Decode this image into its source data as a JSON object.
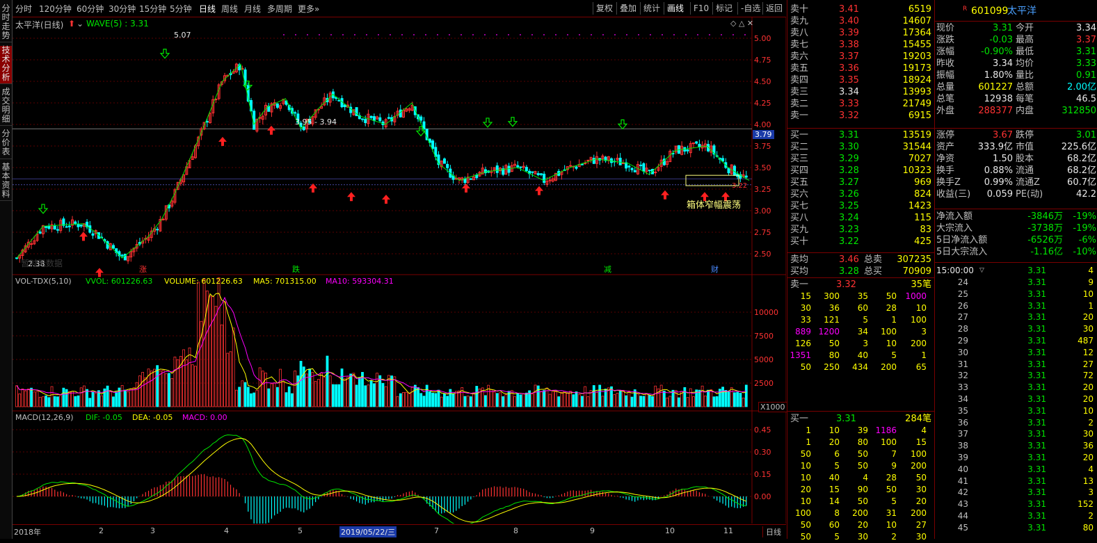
{
  "sidebar": {
    "tabs": [
      {
        "label": "分时走势",
        "active": false
      },
      {
        "label": "技术分析",
        "active": true
      },
      {
        "label": "成交明细",
        "active": false
      },
      {
        "label": "分价表",
        "active": false
      },
      {
        "label": "基本资料",
        "active": false
      }
    ]
  },
  "toolbar": {
    "periods": [
      "分时",
      "120分钟",
      "60分钟",
      "30分钟",
      "15分钟",
      "5分钟",
      "日线",
      "周线",
      "月线",
      "多周期",
      "更多»"
    ],
    "selected_period": "日线",
    "right_buttons": [
      "复权",
      "叠加",
      "统计",
      "画线",
      "F10",
      "标记",
      "-自选",
      "返回"
    ],
    "selected_right": "画线"
  },
  "main_chart": {
    "title": "太平洋(日线)",
    "indicator": "WAVE(5) : 3.31",
    "high_label": "5.07",
    "low_label": "2.38",
    "mark_label": "3.95 - 3.94",
    "last_label": "3.22",
    "current_price_tag": "3.79",
    "annotation": "箱体窄幅震荡",
    "ghost_text": "暂时无数据",
    "y_ticks": [
      "5.00",
      "4.75",
      "4.50",
      "4.25",
      "4.00",
      "3.75",
      "3.50",
      "3.25",
      "3.00",
      "2.75",
      "2.50"
    ],
    "event_marks": [
      "涨",
      "跌",
      "减",
      "财"
    ]
  },
  "vol_panel": {
    "name": "VOL-TDX(5,10)",
    "vvol": "VVOL: 601226.63",
    "volume": "VOLUME: 601226.63",
    "ma5": "MA5: 701315.00",
    "ma10": "MA10: 593304.31",
    "y_ticks": [
      "10000",
      "7500",
      "5000",
      "2500"
    ],
    "unit": "X1000"
  },
  "macd_panel": {
    "name": "MACD(12,26,9)",
    "dif": "DIF: -0.05",
    "dea": "DEA: -0.05",
    "macd": "MACD: 0.00",
    "y_ticks": [
      "0.45",
      "0.30",
      "0.15",
      "0.00"
    ]
  },
  "x_axis": {
    "labels": [
      "2018年",
      "2",
      "3",
      "4",
      "5",
      "6",
      "7",
      "8",
      "9",
      "10",
      "11"
    ],
    "cursor_date": "2019/05/22/三",
    "period_btn": "日线"
  },
  "order_book": {
    "asks": [
      {
        "label": "卖十",
        "price": "3.41",
        "vol": "6519"
      },
      {
        "label": "卖九",
        "price": "3.40",
        "vol": "14607"
      },
      {
        "label": "卖八",
        "price": "3.39",
        "vol": "17364"
      },
      {
        "label": "卖七",
        "price": "3.38",
        "vol": "15455"
      },
      {
        "label": "卖六",
        "price": "3.37",
        "vol": "19203"
      },
      {
        "label": "卖五",
        "price": "3.36",
        "vol": "19173"
      },
      {
        "label": "卖四",
        "price": "3.35",
        "vol": "18924"
      },
      {
        "label": "卖三",
        "price": "3.34",
        "vol": "13993"
      },
      {
        "label": "卖二",
        "price": "3.33",
        "vol": "21749"
      },
      {
        "label": "卖一",
        "price": "3.32",
        "vol": "6915"
      }
    ],
    "bids": [
      {
        "label": "买一",
        "price": "3.31",
        "vol": "13519"
      },
      {
        "label": "买二",
        "price": "3.30",
        "vol": "31544"
      },
      {
        "label": "买三",
        "price": "3.29",
        "vol": "7027"
      },
      {
        "label": "买四",
        "price": "3.28",
        "vol": "10323"
      },
      {
        "label": "买五",
        "price": "3.27",
        "vol": "969"
      },
      {
        "label": "买六",
        "price": "3.26",
        "vol": "824"
      },
      {
        "label": "买七",
        "price": "3.25",
        "vol": "1423"
      },
      {
        "label": "买八",
        "price": "3.24",
        "vol": "115"
      },
      {
        "label": "买九",
        "price": "3.23",
        "vol": "83"
      },
      {
        "label": "买十",
        "price": "3.22",
        "vol": "425"
      }
    ],
    "avg_ask": {
      "label": "卖均",
      "price": "3.46",
      "total_label": "总卖",
      "total": "307235"
    },
    "avg_bid": {
      "label": "买均",
      "price": "3.28",
      "total_label": "总买",
      "total": "70909"
    }
  },
  "ask_queue": {
    "label": "卖一",
    "price": "3.32",
    "count": "35笔",
    "rows": [
      [
        "15",
        "300",
        "35",
        "50",
        "1000"
      ],
      [
        "30",
        "36",
        "60",
        "28",
        "10"
      ],
      [
        "33",
        "121",
        "5",
        "1",
        "100"
      ],
      [
        "889",
        "1200",
        "34",
        "100",
        "3"
      ],
      [
        "126",
        "50",
        "3",
        "10",
        "200"
      ],
      [
        "1351",
        "80",
        "40",
        "5",
        "1"
      ],
      [
        "50",
        "250",
        "434",
        "200",
        "65"
      ]
    ]
  },
  "bid_queue": {
    "label": "买一",
    "price": "3.31",
    "count": "284笔",
    "rows": [
      [
        "1",
        "10",
        "39",
        "1186",
        "4"
      ],
      [
        "1",
        "20",
        "80",
        "100",
        "15"
      ],
      [
        "50",
        "6",
        "50",
        "7",
        "100"
      ],
      [
        "10",
        "5",
        "50",
        "9",
        "200"
      ],
      [
        "10",
        "40",
        "4",
        "28",
        "50"
      ],
      [
        "20",
        "15",
        "90",
        "50",
        "30"
      ],
      [
        "10",
        "14",
        "50",
        "5",
        "20"
      ],
      [
        "100",
        "8",
        "200",
        "31",
        "200"
      ],
      [
        "50",
        "60",
        "20",
        "10",
        "27"
      ],
      [
        "50",
        "5",
        "30",
        "2",
        "30"
      ]
    ]
  },
  "stock": {
    "code": "601099",
    "name": "太平洋",
    "badge": "R"
  },
  "quote": [
    [
      {
        "k": "现价",
        "v": "3.31",
        "c": "green"
      },
      {
        "k": "今开",
        "v": "3.34",
        "c": "white"
      }
    ],
    [
      {
        "k": "涨跌",
        "v": "-0.03",
        "c": "green"
      },
      {
        "k": "最高",
        "v": "3.37",
        "c": "red"
      }
    ],
    [
      {
        "k": "涨幅",
        "v": "-0.90%",
        "c": "green"
      },
      {
        "k": "最低",
        "v": "3.31",
        "c": "green"
      }
    ],
    [
      {
        "k": "昨收",
        "v": "3.34",
        "c": "white"
      },
      {
        "k": "均价",
        "v": "3.33",
        "c": "green"
      }
    ],
    [
      {
        "k": "振幅",
        "v": "1.80%",
        "c": "white"
      },
      {
        "k": "量比",
        "v": "0.91",
        "c": "green"
      }
    ],
    [
      {
        "k": "总量",
        "v": "601227",
        "c": "yellow"
      },
      {
        "k": "总额",
        "v": "2.00亿",
        "c": "cyan"
      }
    ],
    [
      {
        "k": "总笔",
        "v": "12938",
        "c": "white"
      },
      {
        "k": "每笔",
        "v": "46.5",
        "c": "white"
      }
    ],
    [
      {
        "k": "外盘",
        "v": "288377",
        "c": "red"
      },
      {
        "k": "内盘",
        "v": "312850",
        "c": "green"
      }
    ]
  ],
  "fundamentals": [
    [
      {
        "k": "涨停",
        "v": "3.67",
        "c": "red"
      },
      {
        "k": "跌停",
        "v": "3.01",
        "c": "green"
      }
    ],
    [
      {
        "k": "资产",
        "v": "333.9亿",
        "c": "white"
      },
      {
        "k": "市值",
        "v": "225.6亿",
        "c": "white"
      }
    ],
    [
      {
        "k": "净资",
        "v": "1.50",
        "c": "white"
      },
      {
        "k": "股本",
        "v": "68.2亿",
        "c": "white"
      }
    ],
    [
      {
        "k": "换手",
        "v": "0.88%",
        "c": "white"
      },
      {
        "k": "流通",
        "v": "68.2亿",
        "c": "white"
      }
    ],
    [
      {
        "k": "换手Z",
        "v": "0.99%",
        "c": "white"
      },
      {
        "k": "流通Z",
        "v": "60.7亿",
        "c": "white"
      }
    ],
    [
      {
        "k": "收益(三)",
        "v": "0.059",
        "c": "white"
      },
      {
        "k": "PE(动)",
        "v": "42.2",
        "c": "white"
      }
    ]
  ],
  "flows": [
    {
      "k": "净流入额",
      "v": "-3846万",
      "p": "-19%"
    },
    {
      "k": "大宗流入",
      "v": "-3738万",
      "p": "-19%"
    },
    {
      "k": "5日净流入额",
      "v": "-6526万",
      "p": "-6%"
    },
    {
      "k": "5日大宗流入",
      "v": "-1.16亿",
      "p": "-10%"
    }
  ],
  "ticks": {
    "header_time": "15:00:00",
    "header_price": "3.31",
    "header_vol": "4",
    "rows": [
      [
        "24",
        "3.31",
        "9"
      ],
      [
        "25",
        "3.31",
        "10"
      ],
      [
        "26",
        "3.31",
        "1"
      ],
      [
        "27",
        "3.31",
        "20"
      ],
      [
        "28",
        "3.31",
        "30"
      ],
      [
        "29",
        "3.31",
        "487"
      ],
      [
        "30",
        "3.31",
        "12"
      ],
      [
        "31",
        "3.31",
        "27"
      ],
      [
        "32",
        "3.31",
        "72"
      ],
      [
        "33",
        "3.31",
        "20"
      ],
      [
        "34",
        "3.31",
        "20"
      ],
      [
        "35",
        "3.31",
        "10"
      ],
      [
        "36",
        "3.31",
        "2"
      ],
      [
        "37",
        "3.31",
        "30"
      ],
      [
        "38",
        "3.31",
        "36"
      ],
      [
        "39",
        "3.31",
        "20"
      ],
      [
        "40",
        "3.31",
        "4"
      ],
      [
        "41",
        "3.31",
        "13"
      ],
      [
        "42",
        "3.31",
        "3"
      ],
      [
        "43",
        "3.31",
        "152"
      ],
      [
        "44",
        "3.31",
        "2"
      ],
      [
        "45",
        "3.31",
        "80"
      ]
    ]
  },
  "colors": {
    "up": "#ff3232",
    "down": "#00ffff",
    "grid": "#7a0000",
    "ma_yellow": "#ffff00",
    "ma_magenta": "#ff00ff",
    "wave": "#00e600"
  }
}
